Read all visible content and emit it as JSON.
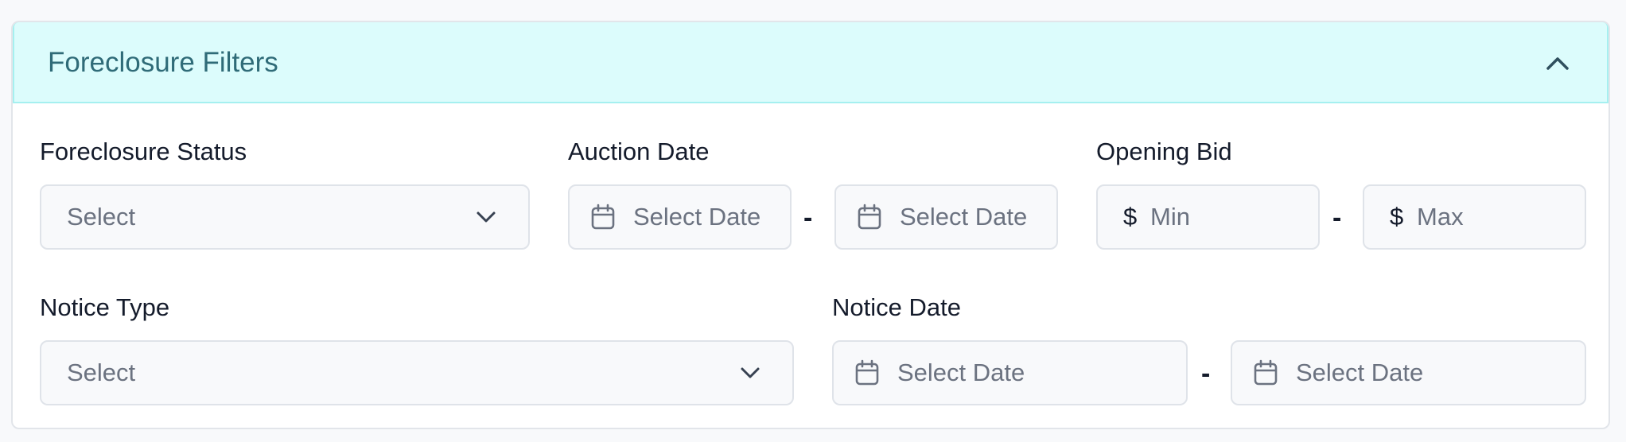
{
  "panel": {
    "title": "Foreclosure Filters",
    "collapse_icon": "chevron-up-icon"
  },
  "foreclosure_status": {
    "label": "Foreclosure Status",
    "value": "Select",
    "icon": "chevron-down-icon"
  },
  "auction_date": {
    "label": "Auction Date",
    "from_placeholder": "Select Date",
    "to_placeholder": "Select Date",
    "separator": "-",
    "icon": "calendar-icon"
  },
  "opening_bid": {
    "label": "Opening Bid",
    "currency": "$",
    "min_placeholder": "Min",
    "max_placeholder": "Max",
    "separator": "-"
  },
  "notice_type": {
    "label": "Notice Type",
    "value": "Select",
    "icon": "chevron-down-icon"
  },
  "notice_date": {
    "label": "Notice Date",
    "from_placeholder": "Select Date",
    "to_placeholder": "Select Date",
    "separator": "-",
    "icon": "calendar-icon"
  },
  "colors": {
    "header_bg": "#dcfcfc",
    "header_border": "#a5f0f0",
    "title_color": "#2f6b78",
    "input_bg": "#f8f9fb",
    "input_border": "#dfe3e9",
    "placeholder": "#6b7280"
  }
}
